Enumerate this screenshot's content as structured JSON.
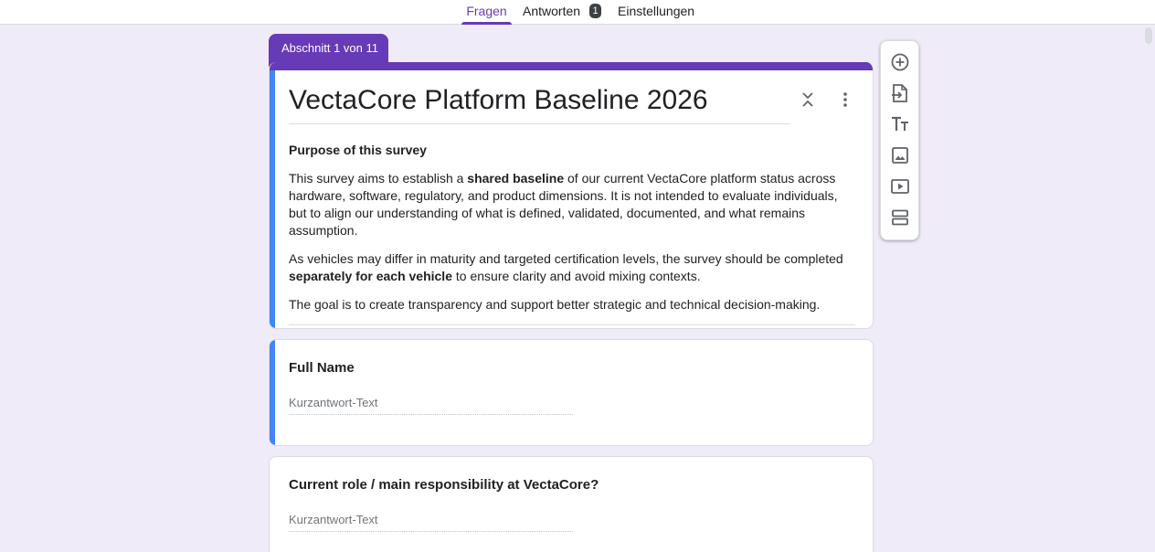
{
  "tabs": [
    {
      "label": "Fragen"
    },
    {
      "label": "Antworten",
      "badge": "1"
    },
    {
      "label": "Einstellungen"
    }
  ],
  "section": {
    "label": "Abschnitt 1 von 11"
  },
  "form": {
    "title": "VectaCore Platform Baseline 2026",
    "description": {
      "heading": "Purpose of this survey",
      "p1_a": "This survey aims to establish a ",
      "p1_b": "shared baseline",
      "p1_c": " of our current VectaCore platform status across hardware, software, regulatory, and product dimensions. It is not intended to evaluate individuals, but to align our understanding of what is defined, validated, documented, and what remains assumption.",
      "p2_a": "As vehicles may differ in maturity and targeted certification levels, the survey should be completed ",
      "p2_b": "separately for each vehicle",
      "p2_c": " to ensure clarity and avoid mixing contexts.",
      "p3": "The goal is to create transparency and support better strategic and technical decision-making."
    }
  },
  "questions": [
    {
      "title": "Full Name",
      "placeholder": "Kurzantwort-Text"
    },
    {
      "title": "Current role / main responsibility at VectaCore?",
      "placeholder": "Kurzantwort-Text"
    }
  ],
  "toolbar": {
    "icons": [
      "add-question-icon",
      "import-questions-icon",
      "add-title-icon",
      "add-image-icon",
      "add-video-icon",
      "add-section-icon"
    ]
  },
  "colors": {
    "accent": "#673ab7",
    "active_bar": "#4285f4",
    "background": "#f0ebf8"
  }
}
